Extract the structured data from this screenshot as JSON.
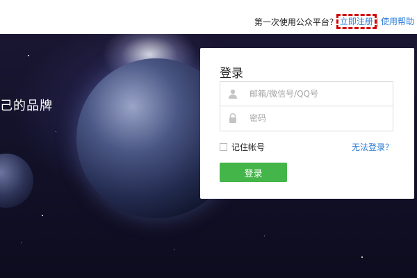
{
  "topbar": {
    "first_time_text": "第一次使用公众平台？",
    "register_link": "立即注册",
    "separator": "|",
    "help_link": "使用帮助"
  },
  "banner": {
    "slogan": "己的品牌"
  },
  "login": {
    "title": "登录",
    "username_placeholder": "邮箱/微信号/QQ号",
    "password_placeholder": "密码",
    "remember_label": "记住帐号",
    "cant_login_link": "无法登录？",
    "submit_label": "登录"
  },
  "icons": {
    "user": "user-icon",
    "lock": "lock-icon"
  },
  "colors": {
    "link": "#2b7bd6",
    "button": "#44b549",
    "highlight": "#d40000"
  }
}
